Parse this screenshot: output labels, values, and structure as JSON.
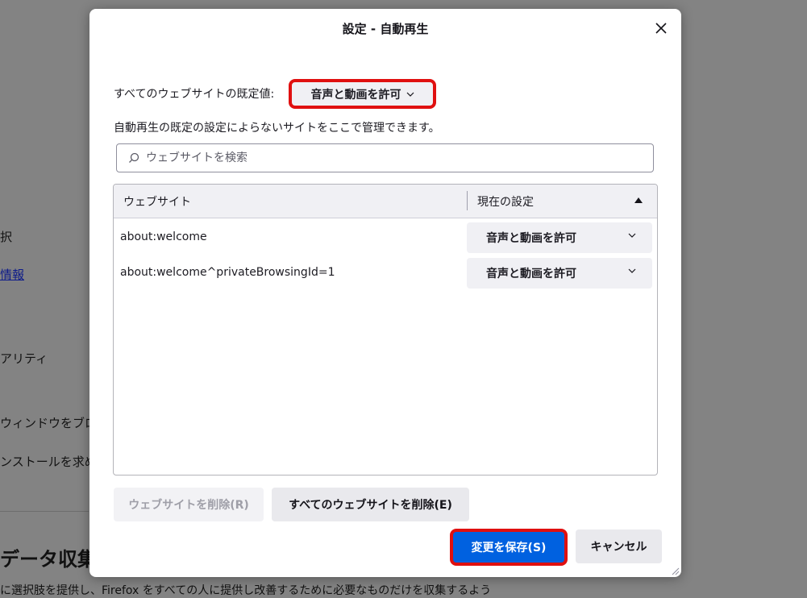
{
  "background": {
    "items": [
      "択",
      "情報",
      "アリティ",
      "ウィンドウをブロッ",
      "ンストールを求め"
    ],
    "heading": "データ収集と",
    "footer": "に選択肢を提供し、Firefox をすべての人に提供し改善するために必要なものだけを収集するよう"
  },
  "dialog": {
    "title": "設定 - 自動再生",
    "close_icon": "close-icon",
    "default_label": "すべてのウェブサイトの既定値:",
    "default_value": "音声と動画を許可",
    "description": "自動再生の既定の設定によらないサイトをここで管理できます。",
    "search_placeholder": "ウェブサイトを検索",
    "table": {
      "columns": [
        "ウェブサイト",
        "現在の設定"
      ],
      "rows": [
        {
          "site": "about:welcome",
          "setting": "音声と動画を許可"
        },
        {
          "site": "about:welcome^privateBrowsingId=1",
          "setting": "音声と動画を許可"
        }
      ]
    },
    "buttons": {
      "remove": "ウェブサイトを削除(R)",
      "remove_all": "すべてのウェブサイトを削除(E)",
      "save": "変更を保存(S)",
      "cancel": "キャンセル"
    },
    "highlight_color": "#e01010",
    "accent_color": "#0061e0"
  }
}
